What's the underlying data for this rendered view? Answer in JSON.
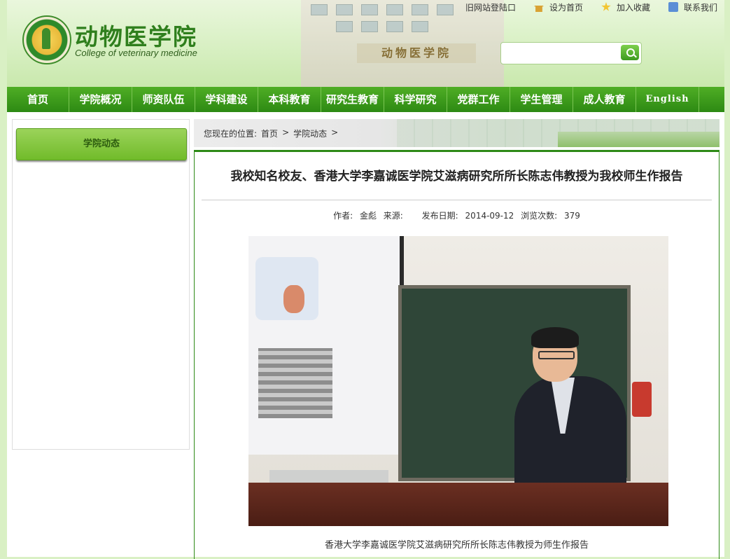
{
  "header": {
    "title": "动物医学院",
    "subtitle": "College of veterinary medicine",
    "building_sign": "动物医学院",
    "top_links": [
      {
        "label": "旧网站登陆口",
        "icon": ""
      },
      {
        "label": "设为首页",
        "icon": "home-icon"
      },
      {
        "label": "加入收藏",
        "icon": "star-icon"
      },
      {
        "label": "联系我们",
        "icon": "mail-icon"
      }
    ],
    "search": {
      "value": "",
      "placeholder": ""
    }
  },
  "nav": {
    "items": [
      "首页",
      "学院概况",
      "师资队伍",
      "学科建设",
      "本科教育",
      "研究生教育",
      "科学研究",
      "党群工作",
      "学生管理",
      "成人教育",
      "English"
    ]
  },
  "sidebar": {
    "button_label": "学院动态"
  },
  "breadcrumb": {
    "prefix": "您现在的位置:",
    "items": [
      "首页",
      "学院动态"
    ],
    "separator": ">"
  },
  "article": {
    "title": "我校知名校友、香港大学李嘉诚医学院艾滋病研究所所长陈志伟教授为我校师生作报告",
    "meta": {
      "author_label": "作者:",
      "author": "金彪",
      "source_label": "来源:",
      "source": "",
      "date_label": "发布日期:",
      "date": "2014-09-12",
      "views_label": "浏览次数:",
      "views": "379"
    },
    "photo_caption": "香港大学李嘉诚医学院艾滋病研究所所长陈志伟教授为师生作报告"
  },
  "colors": {
    "nav_green": "#2d8a13",
    "accent_light_green": "#7cc654",
    "background": "#d9f0c4"
  }
}
